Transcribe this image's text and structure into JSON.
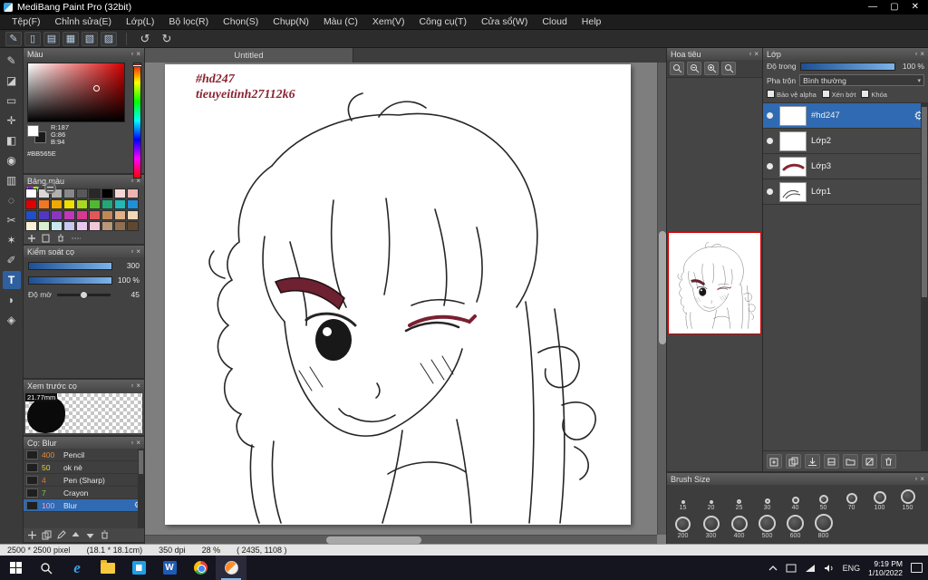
{
  "window": {
    "title": "MediBang Paint Pro (32bit)"
  },
  "icons": {
    "minimize": "—",
    "restore": "▢",
    "close": "✕",
    "panel_float": "▫",
    "panel_close": "×",
    "undo": "↺",
    "redo": "↻",
    "dropdown": "▾",
    "gear": "⚙"
  },
  "menu": {
    "items": [
      "Tệp(F)",
      "Chỉnh sửa(E)",
      "Lớp(L)",
      "Bộ lọc(R)",
      "Chọn(S)",
      "Chụp(N)",
      "Màu (C)",
      "Xem(V)",
      "Công cụ(T)",
      "Cửa sổ(W)",
      "Cloud",
      "Help"
    ]
  },
  "toolbar": {
    "icons": [
      {
        "name": "brush-edit-icon",
        "glyph": "✎"
      },
      {
        "name": "new-page-icon",
        "glyph": "▯"
      },
      {
        "name": "comment-icon",
        "glyph": "▤"
      },
      {
        "name": "grid-icon",
        "glyph": "▦"
      },
      {
        "name": "material-icon",
        "glyph": "▧"
      },
      {
        "name": "table-icon",
        "glyph": "▨"
      }
    ]
  },
  "toolstrip": {
    "tools": [
      {
        "name": "brush-tool",
        "glyph": "✎"
      },
      {
        "name": "eraser-tool",
        "glyph": "◪"
      },
      {
        "name": "select-rect-tool",
        "glyph": "▭"
      },
      {
        "name": "move-tool",
        "glyph": "✛"
      },
      {
        "name": "fill-tool",
        "glyph": "◧"
      },
      {
        "name": "bucket-tool",
        "glyph": "◉"
      },
      {
        "name": "gradient-tool",
        "glyph": "▥"
      },
      {
        "name": "select-ellipse-tool",
        "glyph": "◌"
      },
      {
        "name": "lasso-tool",
        "glyph": "✂"
      },
      {
        "name": "magic-wand-tool",
        "glyph": "✶"
      },
      {
        "name": "select-pen-tool",
        "glyph": "✐"
      },
      {
        "name": "text-tool",
        "glyph": "T",
        "active": true
      },
      {
        "name": "eyedropper-tool",
        "glyph": "◗"
      },
      {
        "name": "hand-tool",
        "glyph": "◈"
      }
    ]
  },
  "color_panel": {
    "title": "Màu",
    "rgb": [
      "R:187",
      "G:86",
      "B:94"
    ],
    "hex": "#BB565E"
  },
  "palette_panel": {
    "title": "Bảng màu",
    "swatches": [
      "#ffffff",
      "#d8d8d8",
      "#b0b0b0",
      "#888888",
      "#585858",
      "#282828",
      "#000000",
      "#f6d7d7",
      "#eeb4b4",
      "#e00000",
      "#f07820",
      "#f0a800",
      "#f0e000",
      "#a8d820",
      "#50b830",
      "#20a878",
      "#20b8b8",
      "#2090d8",
      "#2050c8",
      "#5038c0",
      "#8838c0",
      "#c038b8",
      "#d83890",
      "#e05858",
      "#c08858",
      "#e0b088",
      "#f0d8b8",
      "#f8f0d8",
      "#d8f0d0",
      "#c8e8f0",
      "#c8c8f0",
      "#e8c8f0",
      "#f0c8d8",
      "#b89878",
      "#907050",
      "#604830"
    ]
  },
  "brush_control": {
    "title": "Kiểm soát cọ",
    "size_value": "300",
    "opacity_value": "100 %",
    "blur_label": "Độ mờ",
    "blur_value": "45"
  },
  "brush_preview": {
    "title": "Xem trước cọ",
    "size_label": "21.77mm"
  },
  "brush_list": {
    "title": "Cọ: Blur",
    "rows": [
      {
        "size": "400",
        "name": "Pencil",
        "color": "#e08a3c"
      },
      {
        "size": "50",
        "name": "ok nè",
        "color": "#ded23e"
      },
      {
        "size": "4",
        "name": "Pen (Sharp)",
        "color": "#e0763c"
      },
      {
        "size": "7",
        "name": "Crayon",
        "color": "#8bc34a"
      },
      {
        "size": "100",
        "name": "Blur",
        "color": "#f0a8c8"
      }
    ]
  },
  "canvas": {
    "tab": "Untitled",
    "text_line1": "#hd247",
    "text_line2": "tieuyeitinh27112k6",
    "accent_color": "#8b2433"
  },
  "navigator": {
    "title": "Hoa tiêu"
  },
  "layers_panel": {
    "title": "Lớp",
    "opacity_label": "Độ trong",
    "opacity_value": "100 %",
    "blend_label": "Pha trộn",
    "blend_value": "Bình thường",
    "check_alpha": "Bảo vệ alpha",
    "check_clip": "Xén bớt",
    "check_lock": "Khóa",
    "layers": [
      {
        "name": "#hd247"
      },
      {
        "name": "Lớp2"
      },
      {
        "name": "Lớp3"
      },
      {
        "name": "Lớp1"
      }
    ]
  },
  "brush_size_panel": {
    "title": "Brush Size",
    "row1": [
      {
        "label": "15",
        "d": 3
      },
      {
        "label": "20",
        "d": 4
      },
      {
        "label": "25",
        "d": 5
      },
      {
        "label": "30",
        "d": 6
      },
      {
        "label": "40",
        "d": 8
      },
      {
        "label": "50",
        "d": 10
      },
      {
        "label": "70",
        "d": 12
      },
      {
        "label": "100",
        "d": 14
      },
      {
        "label": "150",
        "d": 16
      }
    ],
    "row2": [
      {
        "label": "200",
        "d": 17
      },
      {
        "label": "300",
        "d": 18
      },
      {
        "label": "400",
        "d": 18
      },
      {
        "label": "500",
        "d": 19
      },
      {
        "label": "600",
        "d": 19
      },
      {
        "label": "800",
        "d": 20
      }
    ]
  },
  "status_bar": {
    "size": "2500 * 2500 pixel",
    "cm": "(18.1 * 18.1cm)",
    "dpi": "350 dpi",
    "zoom": "28 %",
    "coords": "( 2435, 1108 )"
  },
  "taskbar": {
    "lang": "ENG",
    "time": "9:19 PM",
    "date": "1/10/2022"
  }
}
